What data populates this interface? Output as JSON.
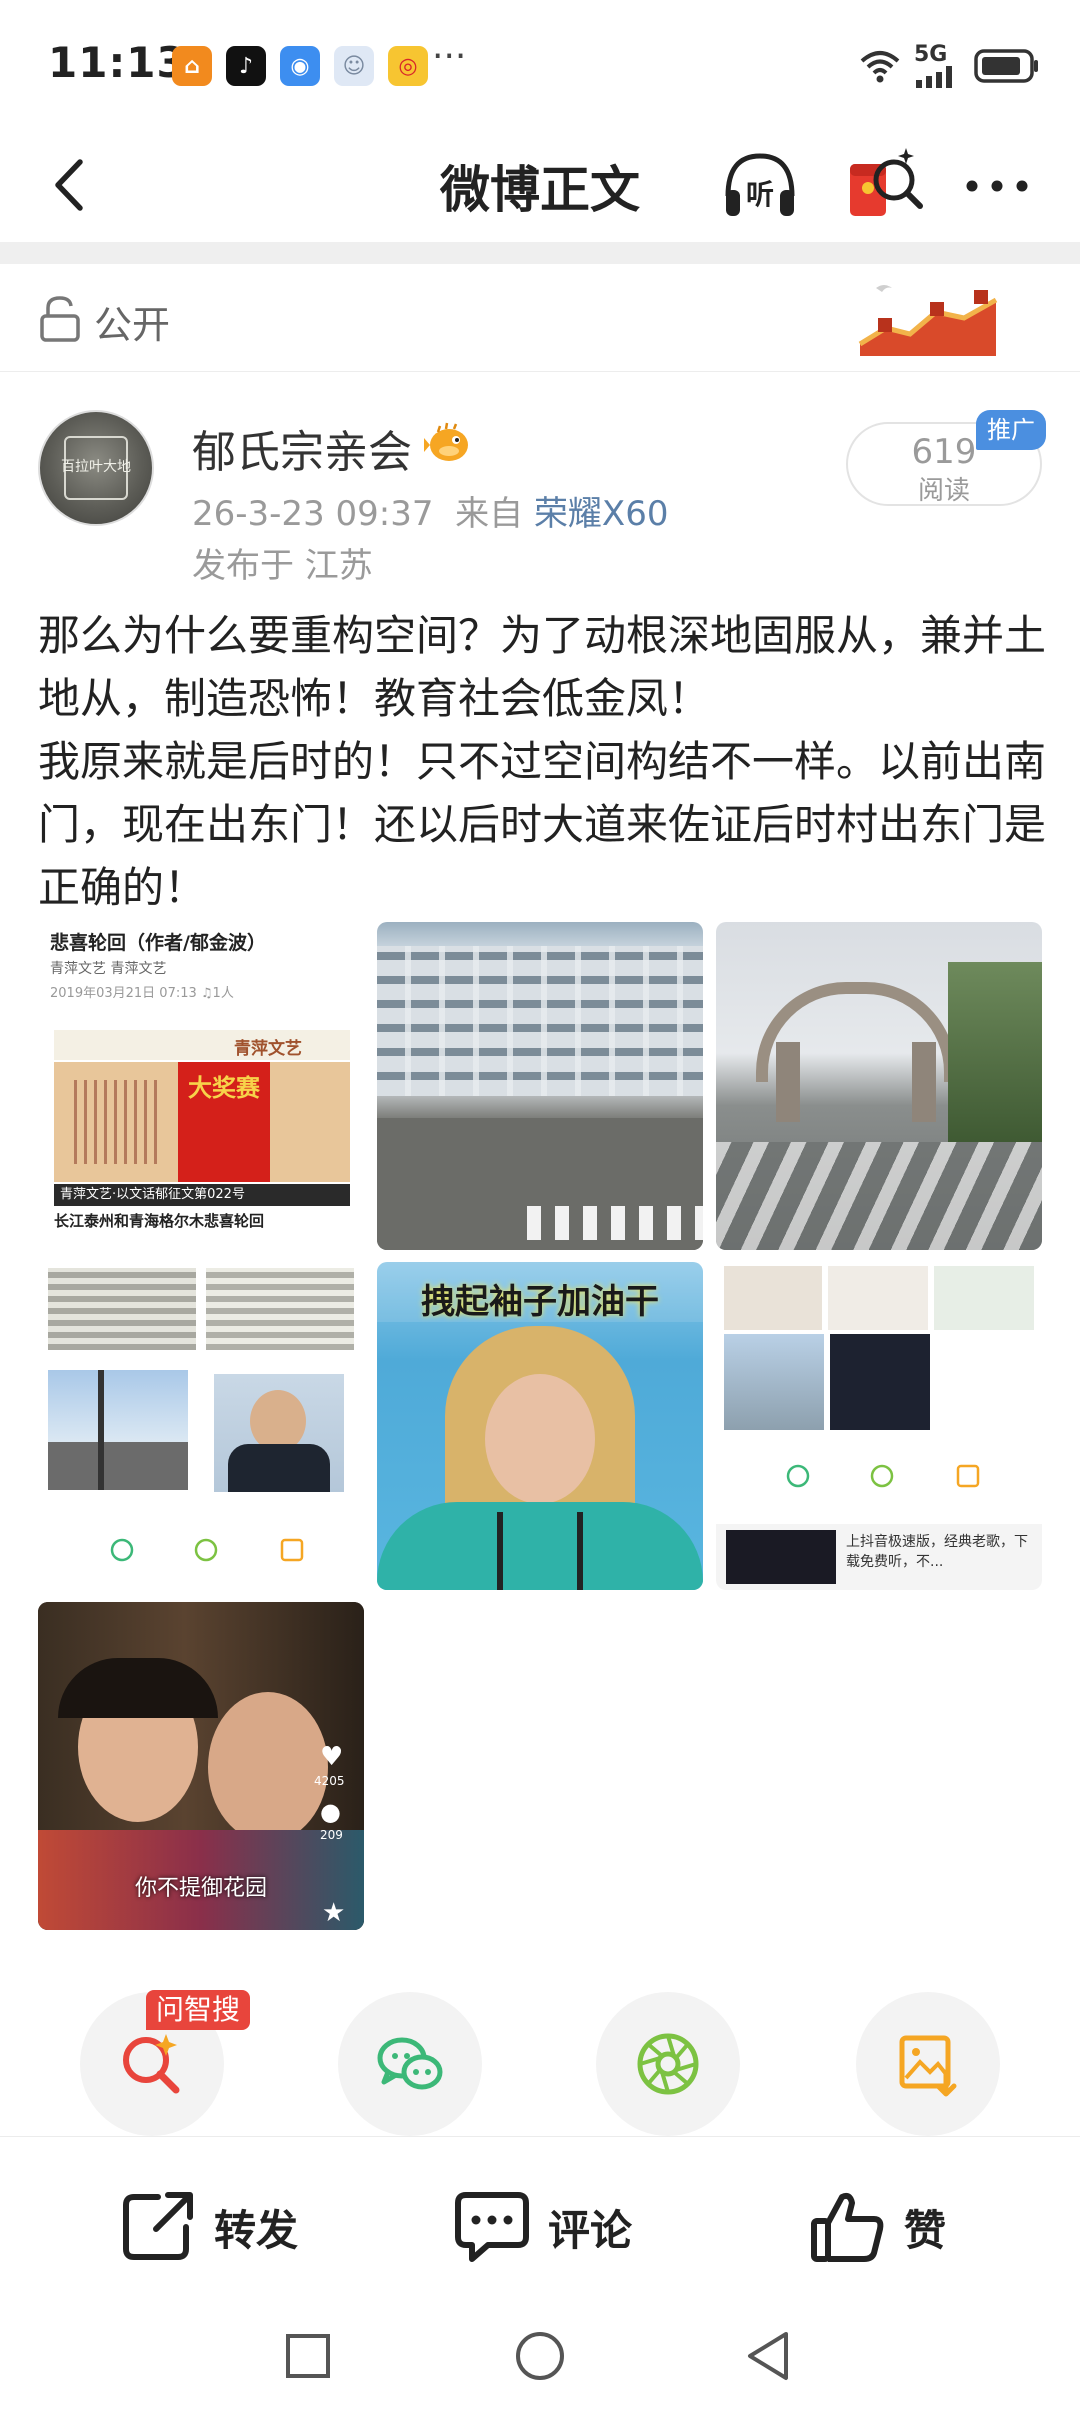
{
  "status_bar": {
    "time": "11:13",
    "more": "···",
    "network": "5G"
  },
  "header": {
    "title": "微博正文",
    "listen_label": "听"
  },
  "visibility": {
    "label": "公开"
  },
  "author": {
    "name": "郁氏宗亲会",
    "avatar_text": "百拉叶大地",
    "date": "26-3-23 09:37",
    "from_prefix": "来自",
    "device": "荣耀X60",
    "location": "发布于 江苏"
  },
  "views": {
    "count": "619",
    "label": "阅读",
    "promo_tag": "推广"
  },
  "post": {
    "paragraphs": [
      "那么为什么要重构空间？为了动根深地固服从，兼并土地从，制造恐怖！教育社会低金凤！",
      "我原来就是后时的！只不过空间构结不一样。以前出南门，现在出东门！还以后时大道来佐证后时村出东门是正确的！"
    ]
  },
  "images": {
    "img1_title": "悲喜轮回（作者/郁金波）",
    "img1_meta": "青萍文艺  青萍文艺",
    "img1_date": "2019年03月21日 07:13  ♫1人",
    "img1_banner": "青萍文艺",
    "img1_award": "大奖赛",
    "img1_caption_a": "青萍文艺·以文话郁征文第022号",
    "img1_caption_b": "长江泰州和青海格尔木悲喜轮回",
    "img5_caption": "拽起袖子加油干",
    "img6_ad": "上抖音极速版，经典老歌，下载免费听，不...",
    "img7_subtitle": "你不提御花园",
    "img7_likes": "4205",
    "img7_comments": "209"
  },
  "actions": {
    "ai_tag": "问智搜"
  },
  "toolbar": {
    "repost": "转发",
    "comment": "评论",
    "like": "赞"
  },
  "colors": {
    "link_blue": "#5b7fa8",
    "promo_blue": "#4b8fe0",
    "ai_red": "#e8453c",
    "wechat_green": "#3cb878",
    "moments_green": "#7cc242",
    "save_orange": "#f5a623"
  }
}
